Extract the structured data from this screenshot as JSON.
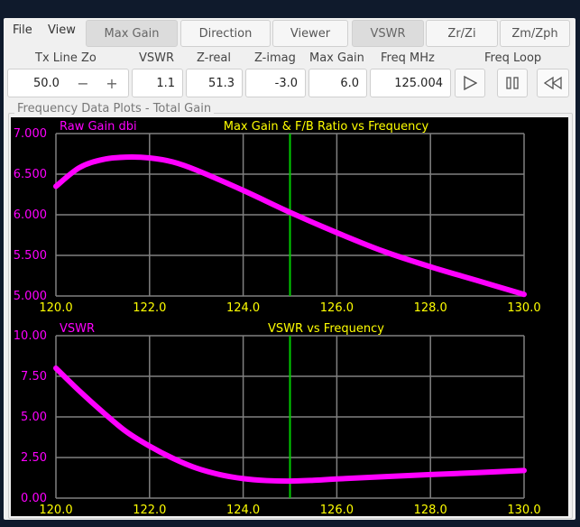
{
  "menu": {
    "file": "File",
    "view": "View"
  },
  "tabs": [
    {
      "label": "Max Gain",
      "active": true
    },
    {
      "label": "Direction",
      "active": false
    },
    {
      "label": "Viewer",
      "active": false
    },
    {
      "label": "VSWR",
      "active": true
    },
    {
      "label": "Zr/Zi",
      "active": false
    },
    {
      "label": "Zm/Zph",
      "active": false
    }
  ],
  "headers": {
    "txline": "Tx Line Zo",
    "vswr": "VSWR",
    "zreal": "Z-real",
    "zimag": "Z-imag",
    "maxgain": "Max Gain",
    "freq": "Freq MHz",
    "loop": "Freq Loop"
  },
  "fields": {
    "txline": "50.0",
    "minus": "−",
    "plus": "+",
    "vswr": "1.1",
    "zreal": "51.3",
    "zimag": "-3.0",
    "maxgain": "6.0",
    "freq": "125.004"
  },
  "icons": {
    "play": "play-icon",
    "pause": "pause-icon",
    "rewind": "rewind-icon"
  },
  "group_title": "Frequency Data Plots - Total Gain",
  "colors": {
    "curve": "#ff00ff",
    "marker": "#00cc00",
    "title": "#ffff00",
    "axis_label": "#ff00ff",
    "tick": "#ffff00",
    "grid": "#808080"
  },
  "chart_data": [
    {
      "type": "line",
      "title": "Max Gain & F/B Ratio vs Frequency",
      "series_label": "Raw Gain dbi",
      "xlim": [
        120,
        130
      ],
      "ylim": [
        5.0,
        7.0
      ],
      "xticks": [
        "120.0",
        "122.0",
        "124.0",
        "126.0",
        "128.0",
        "130.0"
      ],
      "yticks": [
        "7.000",
        "6.500",
        "6.000",
        "5.500",
        "5.000"
      ],
      "marker_x": 125.0,
      "x": [
        120.0,
        120.5,
        121.0,
        121.5,
        122.0,
        122.5,
        123.0,
        124.0,
        125.0,
        126.0,
        127.0,
        128.0,
        129.0,
        130.0
      ],
      "y": [
        6.35,
        6.58,
        6.68,
        6.71,
        6.7,
        6.65,
        6.55,
        6.3,
        6.03,
        5.78,
        5.55,
        5.36,
        5.19,
        5.02
      ]
    },
    {
      "type": "line",
      "title": "VSWR vs Frequency",
      "series_label": "VSWR",
      "xlim": [
        120,
        130
      ],
      "ylim": [
        0,
        10
      ],
      "xticks": [
        "120.0",
        "122.0",
        "124.0",
        "126.0",
        "128.0",
        "130.0"
      ],
      "yticks": [
        "10.00",
        "7.50",
        "5.00",
        "2.50",
        "0.00"
      ],
      "marker_x": 125.0,
      "x": [
        120.0,
        120.5,
        121.0,
        121.5,
        122.0,
        122.5,
        123.0,
        123.5,
        124.0,
        124.5,
        125.0,
        125.5,
        126.0,
        127.0,
        128.0,
        129.0,
        130.0
      ],
      "y": [
        8.0,
        6.6,
        5.3,
        4.1,
        3.2,
        2.45,
        1.85,
        1.45,
        1.2,
        1.08,
        1.05,
        1.1,
        1.18,
        1.32,
        1.45,
        1.57,
        1.7
      ]
    }
  ]
}
